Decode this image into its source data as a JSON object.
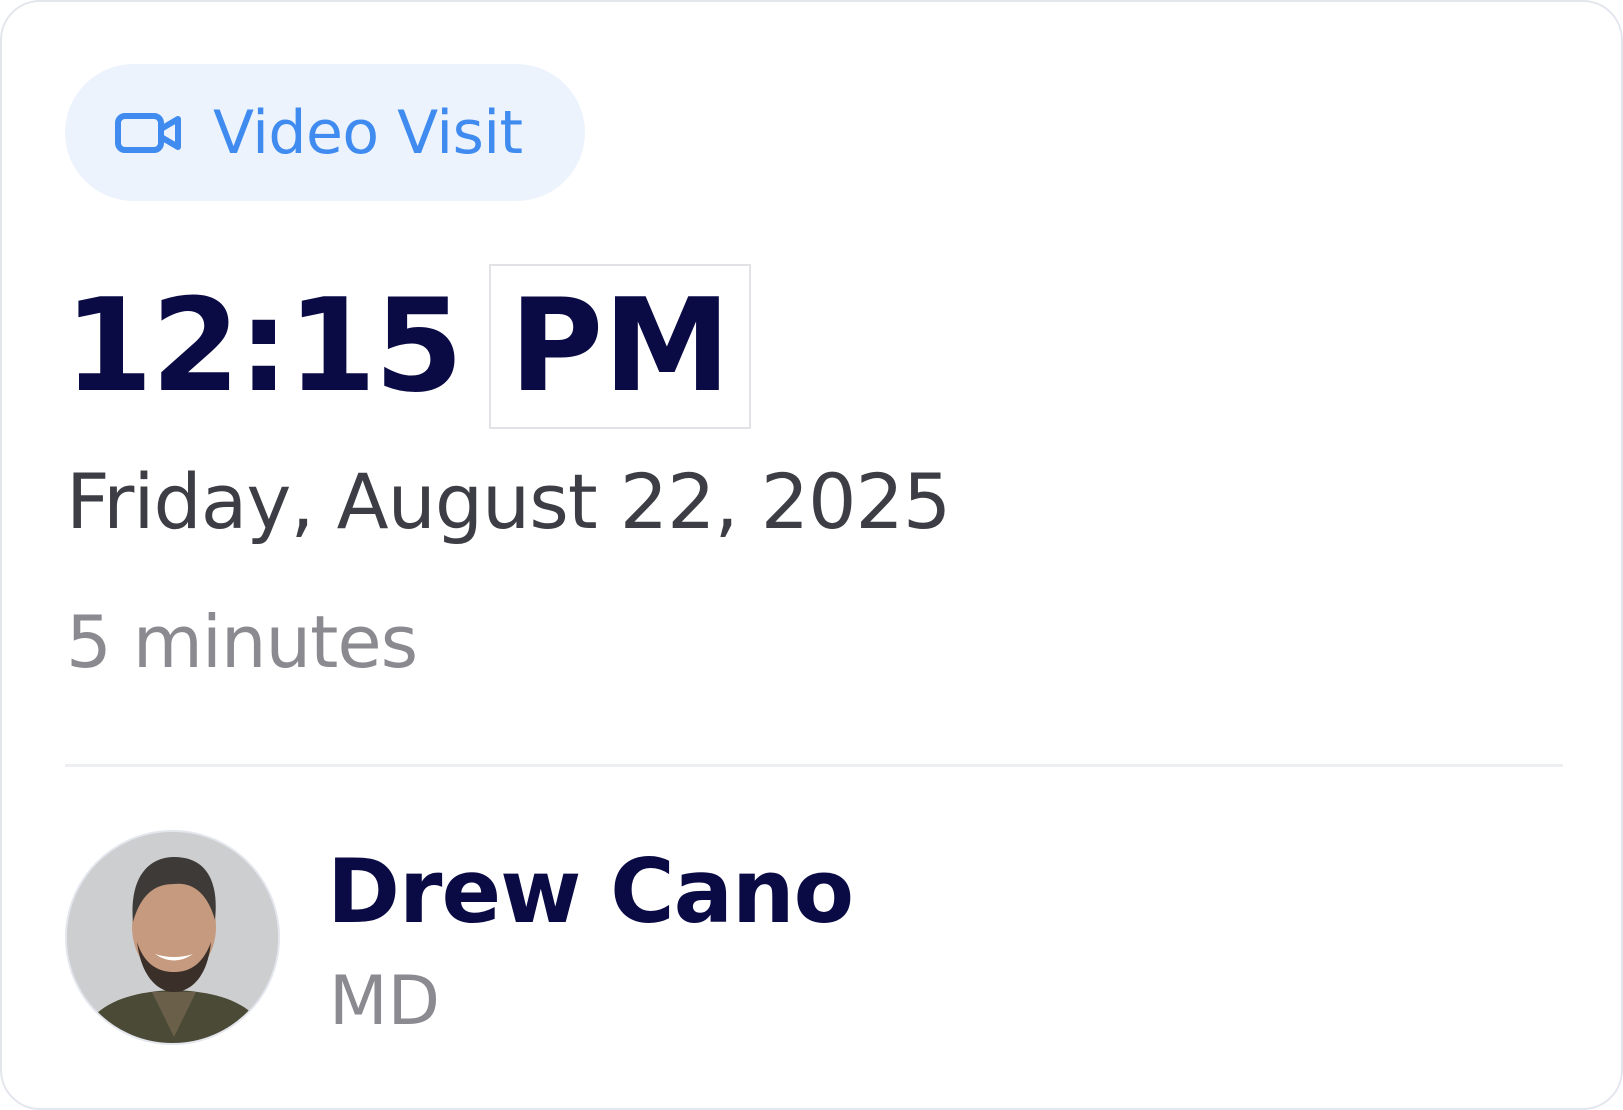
{
  "visit_type": {
    "label": "Video Visit",
    "icon": "video-camera-icon",
    "color": "#3f8bef",
    "background": "#ecf3fc"
  },
  "appointment": {
    "time": "12:15",
    "ampm": "PM",
    "date": "Friday, August 22, 2025",
    "duration": "5 minutes"
  },
  "provider": {
    "name": "Drew Cano",
    "credential": "MD",
    "avatar_icon": "provider-photo"
  },
  "colors": {
    "primary_text": "#0a0a45",
    "secondary_text": "#3d3d45",
    "muted_text": "#8a8a90"
  }
}
